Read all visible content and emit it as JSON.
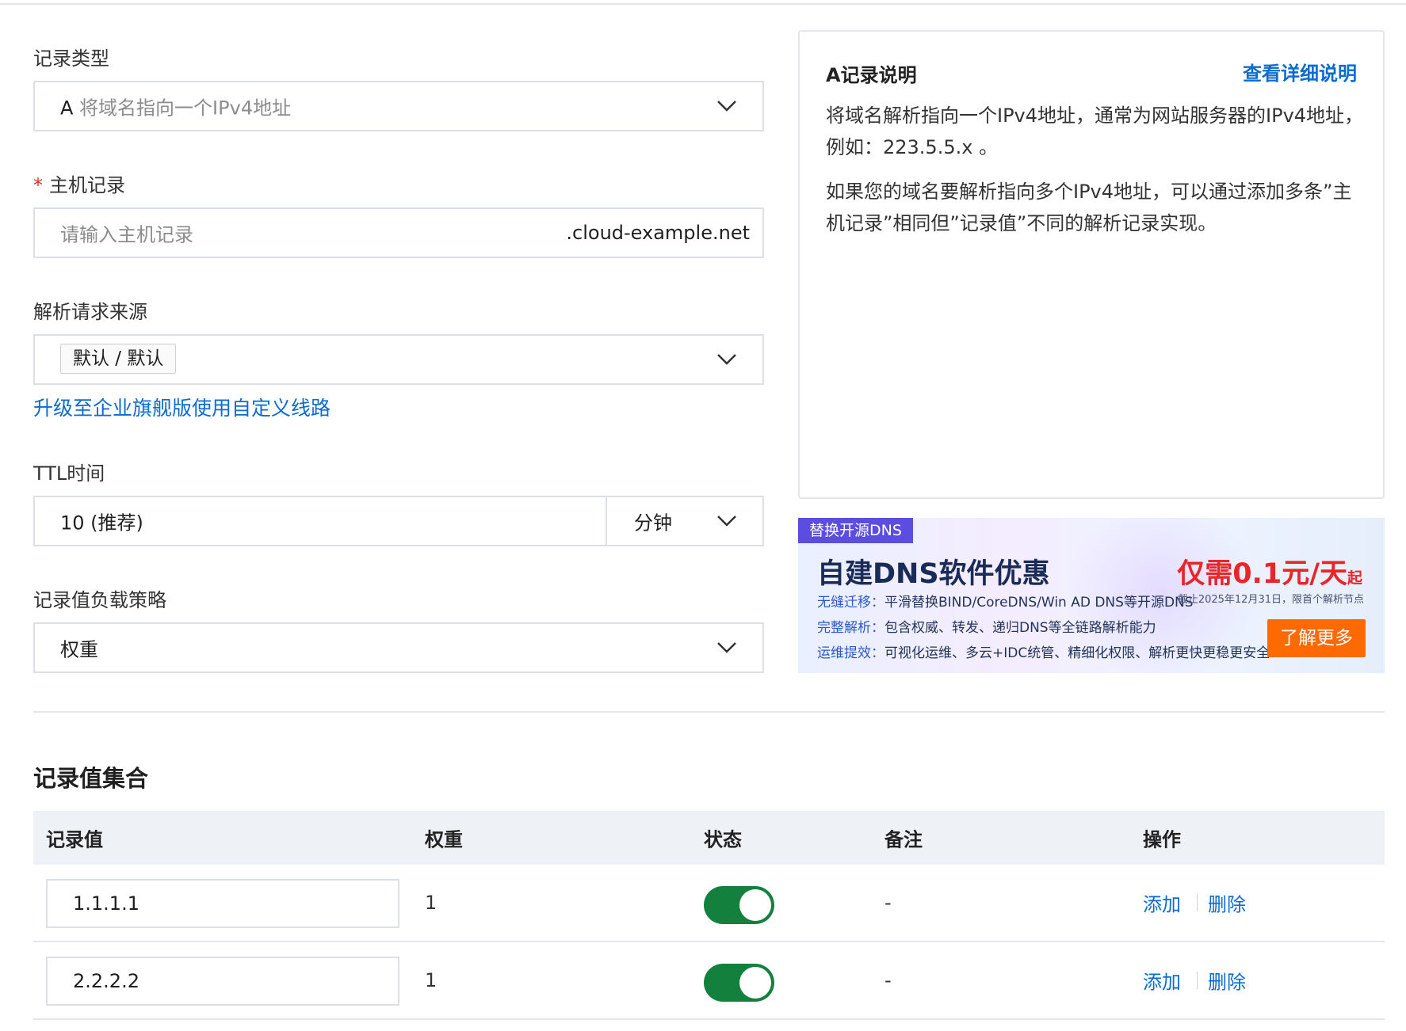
{
  "form": {
    "record_type": {
      "label": "记录类型",
      "value_prefix": "A",
      "value_desc": "将域名指向一个IPv4地址"
    },
    "host": {
      "required_mark": "*",
      "label": "主机记录",
      "placeholder": "请输入主机记录",
      "suffix": ".cloud-example.net"
    },
    "source": {
      "label": "解析请求来源",
      "tag": "默认 / 默认",
      "upgrade_link": "升级至企业旗舰版使用自定义线路"
    },
    "ttl": {
      "label": "TTL时间",
      "value": "10 (推荐)",
      "unit": "分钟"
    },
    "strategy": {
      "label": "记录值负载策略",
      "value": "权重"
    }
  },
  "info_panel": {
    "title": "A记录说明",
    "detail_link": "查看详细说明",
    "para1": "将域名解析指向一个IPv4地址，通常为网站服务器的IPv4地址，例如：223.5.5.x 。",
    "para2": "如果您的域名要解析指向多个IPv4地址，可以通过添加多条”主机记录”相同但”记录值”不同的解析记录实现。"
  },
  "banner": {
    "badge": "替换开源DNS",
    "title": "自建DNS软件优惠",
    "lines": [
      {
        "key": "无缝迁移：",
        "text": "平滑替换BIND/CoreDNS/Win AD DNS等开源DNS"
      },
      {
        "key": "完整解析：",
        "text": "包含权威、转发、递归DNS等全链路解析能力"
      },
      {
        "key": "运维提效：",
        "text": "可视化运维、多云+IDC统管、精细化权限、解析更快更稳更安全"
      }
    ],
    "price": "仅需0.1元/天",
    "price_suffix": "起",
    "note": "截止2025年12月31日，限首个解析节点",
    "button": "了解更多"
  },
  "records": {
    "title": "记录值集合",
    "columns": [
      "记录值",
      "权重",
      "状态",
      "备注",
      "操作"
    ],
    "rows": [
      {
        "value": "1.1.1.1",
        "weight": "1",
        "enabled": true,
        "remark": "-",
        "add": "添加",
        "delete": "删除"
      },
      {
        "value": "2.2.2.2",
        "weight": "1",
        "enabled": true,
        "remark": "-",
        "add": "添加",
        "delete": "删除"
      }
    ]
  },
  "colors": {
    "link": "#0b6bcf",
    "toggle_on": "#13803d",
    "required": "#d93026",
    "banner_button": "#ff6a00",
    "price": "#e8262a"
  }
}
